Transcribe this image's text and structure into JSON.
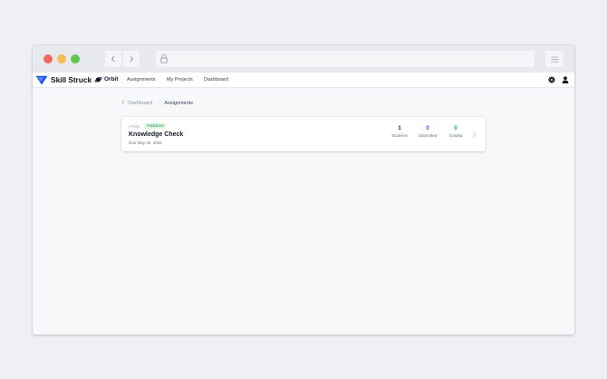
{
  "browser": {
    "icons": {
      "back": "chevron-left-icon",
      "forward": "chevron-right-icon",
      "lock": "lock-icon",
      "menu": "hamburger-menu-icon"
    },
    "colors": {
      "close": "#ee6a5f",
      "minimize": "#f5be4f",
      "maximize": "#62c655"
    }
  },
  "appbar": {
    "brand": "Skill Struck",
    "orbit_label": "Orbit",
    "nav": [
      "Assignments",
      "My Projects",
      "Dashboard"
    ],
    "icons": {
      "settings": "gear-icon",
      "account": "user-icon"
    },
    "colors": {
      "brand_blue": "#1f56e0"
    }
  },
  "breadcrumb": {
    "parent": "Dashboard",
    "separator": "/",
    "current": "Assignments"
  },
  "assignment": {
    "language": "HTML",
    "status": "Published",
    "title": "Knowledge Check",
    "due": "Due May 29, 2026",
    "stats": [
      {
        "value": "1",
        "label": "Students",
        "color": "#111827"
      },
      {
        "value": "0",
        "label": "Submitted",
        "color": "#2563eb"
      },
      {
        "value": "0",
        "label": "Graded",
        "color": "#16a34a"
      }
    ],
    "colors": {
      "badge_bg": "#dff5e5",
      "badge_text": "#2f9e55"
    }
  }
}
